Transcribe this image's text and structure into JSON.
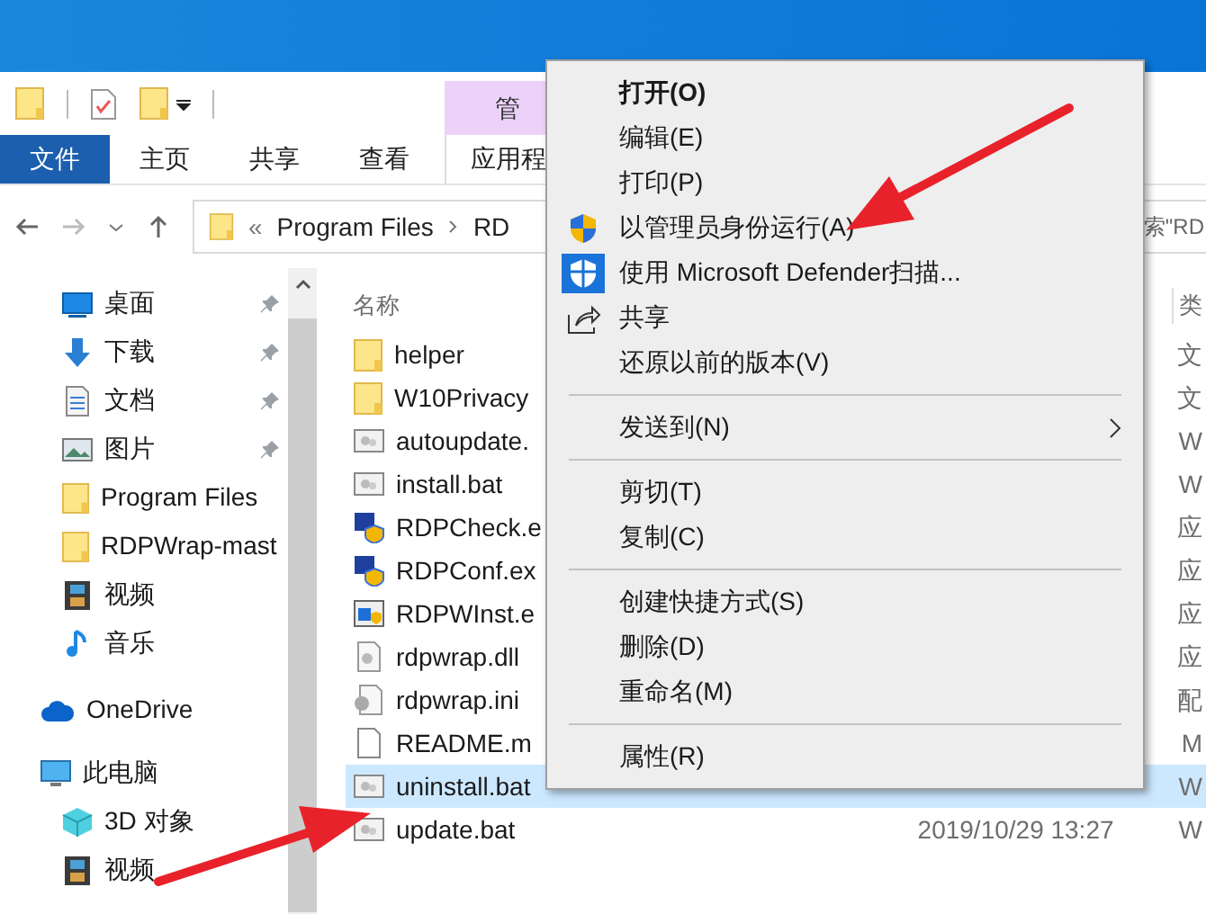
{
  "ribbon": {
    "contextual_group": "管",
    "tabs": [
      {
        "label": "文件",
        "selected": true
      },
      {
        "label": "主页",
        "selected": false
      },
      {
        "label": "共享",
        "selected": false
      },
      {
        "label": "查看",
        "selected": false
      },
      {
        "label": "应用程",
        "selected": false
      }
    ]
  },
  "address_bar": {
    "overflow": "«",
    "path": [
      "Program Files",
      "RD"
    ]
  },
  "search": {
    "placeholder": "索\"RD"
  },
  "nav_pane": {
    "items": [
      {
        "label": "桌面",
        "kind": "desktop",
        "pinned": true
      },
      {
        "label": "下载",
        "kind": "download",
        "pinned": true
      },
      {
        "label": "文档",
        "kind": "document",
        "pinned": true
      },
      {
        "label": "图片",
        "kind": "picture",
        "pinned": true
      },
      {
        "label": "Program Files",
        "kind": "folder",
        "pinned": false
      },
      {
        "label": "RDPWrap-mast",
        "kind": "folder",
        "pinned": false
      },
      {
        "label": "视频",
        "kind": "video",
        "pinned": false
      },
      {
        "label": "音乐",
        "kind": "music",
        "pinned": false
      },
      {
        "label": "OneDrive",
        "kind": "cloud",
        "pinned": false
      },
      {
        "label": "此电脑",
        "kind": "pc",
        "pinned": false
      },
      {
        "label": "3D 对象",
        "kind": "cube",
        "pinned": false
      },
      {
        "label": "视频",
        "kind": "video",
        "pinned": false
      }
    ]
  },
  "file_list": {
    "columns": {
      "name": "名称",
      "column_3": "类"
    },
    "rows": [
      {
        "name": "helper",
        "kind": "folder",
        "column_3": "文",
        "selected": false
      },
      {
        "name": "W10Privacy",
        "kind": "folder",
        "column_3": "文",
        "selected": false
      },
      {
        "name": "autoupdate.",
        "kind": "bat",
        "column_3": "W",
        "selected": false
      },
      {
        "name": "install.bat",
        "kind": "bat",
        "column_3": "W",
        "selected": false
      },
      {
        "name": "RDPCheck.e",
        "kind": "exe",
        "column_3": "应",
        "selected": false
      },
      {
        "name": "RDPConf.ex",
        "kind": "exe",
        "column_3": "应",
        "selected": false
      },
      {
        "name": "RDPWInst.e",
        "kind": "app",
        "column_3": "应",
        "selected": false
      },
      {
        "name": "rdpwrap.dll",
        "kind": "dll",
        "column_3": "应",
        "selected": false
      },
      {
        "name": "rdpwrap.ini",
        "kind": "ini",
        "column_3": "配",
        "selected": false
      },
      {
        "name": "README.m",
        "kind": "file",
        "column_3": "M",
        "selected": false
      },
      {
        "name": "uninstall.bat",
        "kind": "bat",
        "column_3": "W",
        "selected": true
      },
      {
        "name": "update.bat",
        "kind": "bat",
        "date": "2019/10/29 13:27",
        "column_3": "W",
        "selected": false
      }
    ]
  },
  "context_menu": {
    "items": [
      {
        "kind": "item",
        "label": "打开(O)",
        "default": true
      },
      {
        "kind": "item",
        "label": "编辑(E)",
        "default": false
      },
      {
        "kind": "item",
        "label": "打印(P)",
        "default": false
      },
      {
        "kind": "shield",
        "label": "以管理员身份运行(A)",
        "default": false
      },
      {
        "kind": "defender",
        "label": "使用 Microsoft Defender扫描...",
        "default": false
      },
      {
        "kind": "share",
        "label": "共享",
        "default": false
      },
      {
        "kind": "item",
        "label": "还原以前的版本(V)",
        "default": false
      },
      {
        "kind": "separator"
      },
      {
        "kind": "submenu",
        "label": "发送到(N)",
        "default": false
      },
      {
        "kind": "separator"
      },
      {
        "kind": "item",
        "label": "剪切(T)",
        "default": false
      },
      {
        "kind": "item",
        "label": "复制(C)",
        "default": false
      },
      {
        "kind": "separator"
      },
      {
        "kind": "item",
        "label": "创建快捷方式(S)",
        "default": false
      },
      {
        "kind": "item",
        "label": "删除(D)",
        "default": false
      },
      {
        "kind": "item",
        "label": "重命名(M)",
        "default": false
      },
      {
        "kind": "separator"
      },
      {
        "kind": "item",
        "label": "属性(R)",
        "default": false
      }
    ]
  }
}
